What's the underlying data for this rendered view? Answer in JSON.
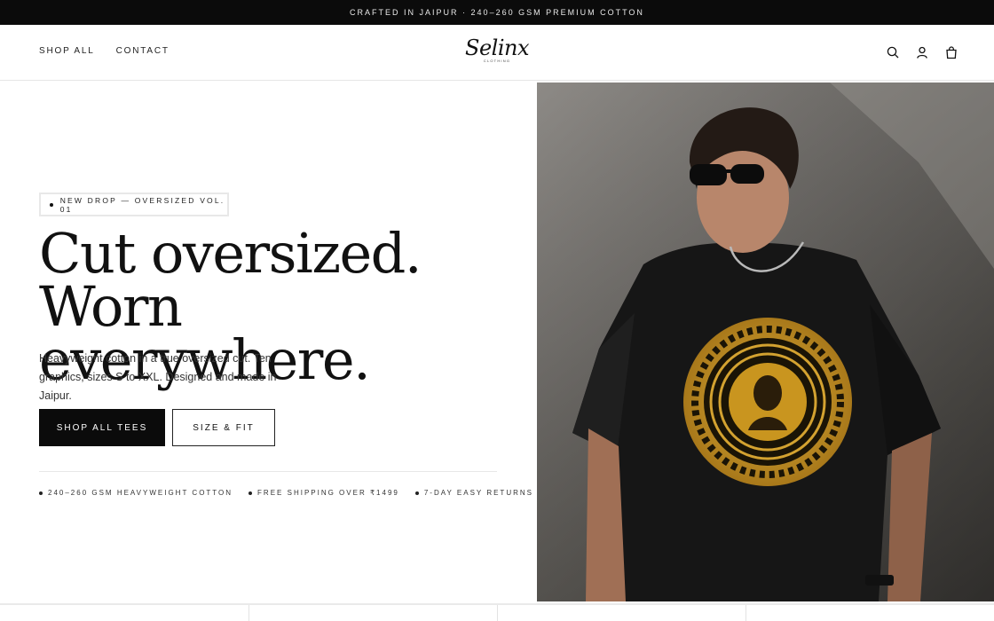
{
  "announcement": {
    "text": "CRAFTED IN JAIPUR · 240–260 GSM PREMIUM COTTON"
  },
  "nav": {
    "items": [
      "SHOP ALL",
      "CONTACT"
    ]
  },
  "brand": {
    "name": "Selinx",
    "tagline": "CLOTHING"
  },
  "header_icons": [
    "search-icon",
    "account-icon",
    "cart-icon"
  ],
  "hero": {
    "badge": "NEW DROP — OVERSIZED VOL. 01",
    "headline_line1": "Cut oversized.",
    "headline_line2": "Worn everywhere.",
    "description": "Heavyweight cotton in a true oversized cut. Ten graphics, sizes S to XXL. Designed and made in Jaipur.",
    "primary_cta": "SHOP ALL TEES",
    "secondary_cta": "SIZE & FIT",
    "features": [
      "240–260 GSM HEAVYWEIGHT COTTON",
      "FREE SHIPPING OVER ₹1499",
      "7-DAY EASY RETURNS"
    ]
  },
  "colors": {
    "announcement_bg": "#0b0b0b",
    "primary_button": "#0b0b0b",
    "graphic_gold": "#c9951f"
  }
}
